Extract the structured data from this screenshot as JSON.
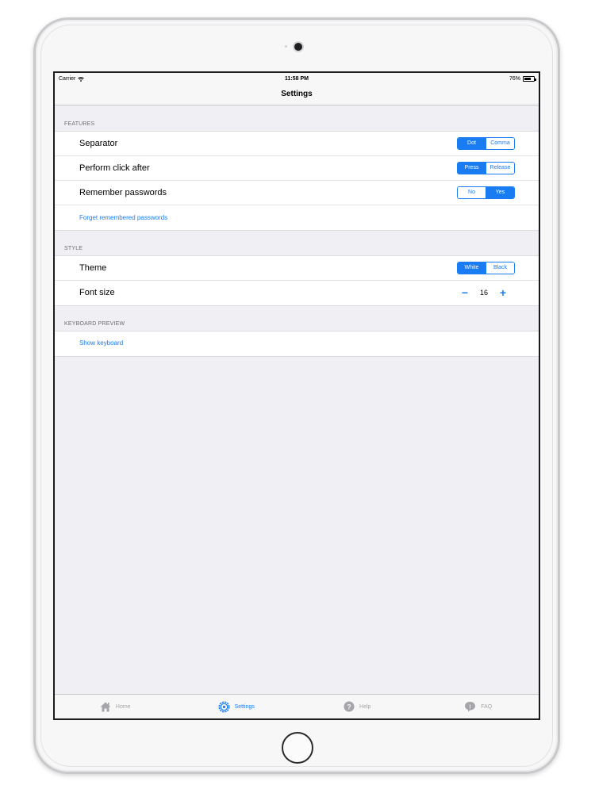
{
  "statusbar": {
    "carrier": "Carrier",
    "time": "11:58 PM",
    "battery": "76%",
    "battery_level": 0.76
  },
  "navbar": {
    "title": "Settings"
  },
  "sections": {
    "features": {
      "header": "FEATURES",
      "separator": {
        "label": "Separator",
        "options": [
          "Dot",
          "Comma"
        ],
        "selected": "Dot"
      },
      "perform_click": {
        "label": "Perform click after",
        "options": [
          "Press",
          "Release"
        ],
        "selected": "Press"
      },
      "remember_passwords": {
        "label": "Remember passwords",
        "options": [
          "No",
          "Yes"
        ],
        "selected": "Yes"
      },
      "forget_link": "Forget remembered passwords"
    },
    "style": {
      "header": "STYLE",
      "theme": {
        "label": "Theme",
        "options": [
          "White",
          "Black"
        ],
        "selected": "White"
      },
      "font_size": {
        "label": "Font size",
        "value": "16",
        "minus": "−",
        "plus": "+"
      }
    },
    "keyboard_preview": {
      "header": "KEYBOARD PREVIEW",
      "show_link": "Show keyboard"
    }
  },
  "tabbar": {
    "tabs": [
      {
        "label": "Home",
        "icon": "home-icon",
        "active": false
      },
      {
        "label": "Settings",
        "icon": "settings-icon",
        "active": true
      },
      {
        "label": "Help",
        "icon": "help-icon",
        "active": false
      },
      {
        "label": "FAQ",
        "icon": "faq-icon",
        "active": false
      }
    ]
  },
  "colors": {
    "accent": "#1a7cf2",
    "inactive": "#a5a5aa",
    "background": "#efeff4"
  }
}
